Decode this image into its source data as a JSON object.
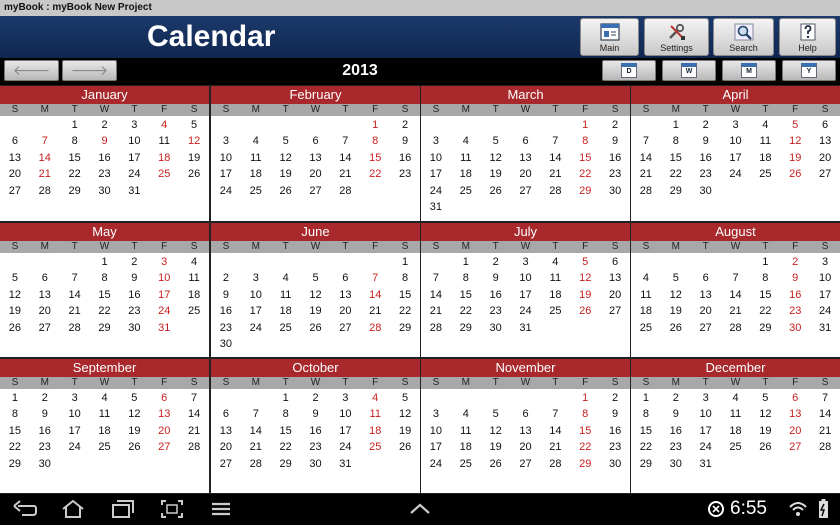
{
  "window": {
    "title": "myBook : myBook New Project"
  },
  "header": {
    "title": "Calendar"
  },
  "toolbar": [
    {
      "name": "main",
      "label": "Main",
      "icon": "main-icon"
    },
    {
      "name": "settings",
      "label": "Settings",
      "icon": "settings-icon"
    },
    {
      "name": "search",
      "label": "Search",
      "icon": "search-icon"
    },
    {
      "name": "help",
      "label": "Help",
      "icon": "help-icon"
    }
  ],
  "nav": {
    "year": "2013",
    "prev_glyph": "🡐",
    "next_glyph": "🡒",
    "views": [
      {
        "name": "day",
        "label": "D"
      },
      {
        "name": "week",
        "label": "W"
      },
      {
        "name": "month",
        "label": "M"
      },
      {
        "name": "year",
        "label": "Y"
      }
    ]
  },
  "weekdays": [
    "S",
    "M",
    "T",
    "W",
    "T",
    "F",
    "S"
  ],
  "months": [
    {
      "name": "January",
      "offset": 2,
      "days": 31,
      "highlight": [
        4,
        7,
        9,
        12,
        14,
        18,
        21,
        25
      ]
    },
    {
      "name": "February",
      "offset": 5,
      "days": 28,
      "highlight": [
        1,
        8,
        15,
        22
      ]
    },
    {
      "name": "March",
      "offset": 5,
      "days": 31,
      "highlight": [
        1,
        8,
        15,
        22,
        29
      ]
    },
    {
      "name": "April",
      "offset": 1,
      "days": 30,
      "highlight": [
        5,
        12,
        19,
        26
      ]
    },
    {
      "name": "May",
      "offset": 3,
      "days": 31,
      "highlight": [
        3,
        10,
        17,
        24,
        31
      ]
    },
    {
      "name": "June",
      "offset": 6,
      "days": 30,
      "highlight": [
        7,
        14,
        28
      ]
    },
    {
      "name": "July",
      "offset": 1,
      "days": 31,
      "highlight": [
        5,
        12,
        19,
        26
      ]
    },
    {
      "name": "August",
      "offset": 4,
      "days": 31,
      "highlight": [
        2,
        9,
        16,
        23,
        30
      ]
    },
    {
      "name": "September",
      "offset": 0,
      "days": 30,
      "highlight": [
        6,
        13,
        20,
        27
      ]
    },
    {
      "name": "October",
      "offset": 2,
      "days": 31,
      "highlight": [
        4,
        11,
        18,
        25
      ]
    },
    {
      "name": "November",
      "offset": 5,
      "days": 30,
      "highlight": [
        1,
        8,
        15,
        22,
        29
      ]
    },
    {
      "name": "December",
      "offset": 0,
      "days": 31,
      "highlight": [
        6,
        13,
        20,
        27
      ]
    }
  ],
  "status": {
    "time": "6:55"
  },
  "colors": {
    "header": "#0f2650",
    "month_header": "#a8282c",
    "highlight": "#c81e1e"
  }
}
